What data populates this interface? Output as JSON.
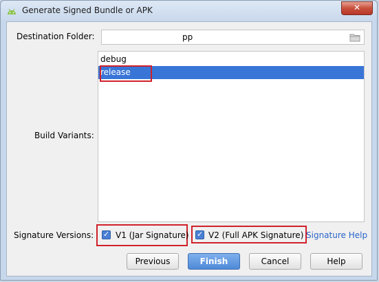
{
  "window": {
    "title": "Generate Signed Bundle or APK",
    "close_glyph": "✕",
    "icon": "android-icon"
  },
  "form": {
    "destination_label": "Destination Folder:",
    "destination_value": "pp",
    "build_variants_label": "Build Variants:",
    "variants": [
      "debug",
      "release"
    ],
    "selected_variant": "release",
    "signature_label": "Signature Versions:",
    "v1_label": "V1 (Jar Signature)",
    "v1_checked": true,
    "v2_label": "V2 (Full APK Signature)",
    "v2_checked": true,
    "help_link": "Signature Help"
  },
  "buttons": {
    "previous": "Previous",
    "finish": "Finish",
    "cancel": "Cancel",
    "help": "Help"
  },
  "colors": {
    "selection": "#3875d7",
    "highlight_box": "#d0202a",
    "link": "#2a64c8"
  }
}
